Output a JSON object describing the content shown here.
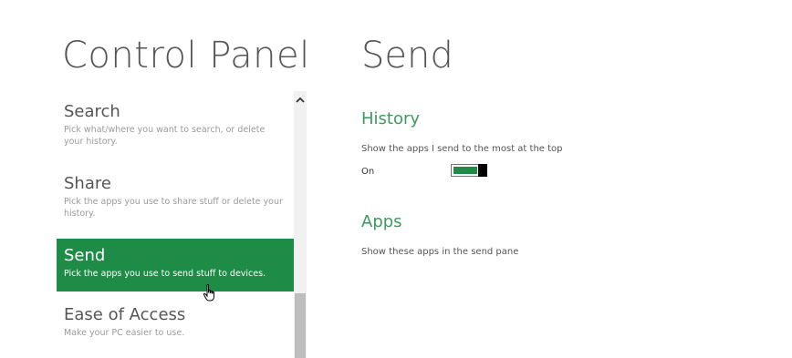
{
  "left_panel": {
    "title": "Control Panel",
    "items": [
      {
        "title": "Search",
        "desc": "Pick what/where you want to search, or delete your history."
      },
      {
        "title": "Share",
        "desc": "Pick the apps you use to share stuff or delete your history."
      },
      {
        "title": "Send",
        "desc": "Pick the apps you use to send stuff to devices."
      },
      {
        "title": "Ease of Access",
        "desc": "Make your PC easier to use."
      }
    ],
    "selected_index": 2
  },
  "right_panel": {
    "title": "Send",
    "history": {
      "heading": "History",
      "description": "Show the apps I send to the most at the top",
      "toggle_label": "On",
      "toggle_on": true
    },
    "apps": {
      "heading": "Apps",
      "description": "Show these apps in the send pane"
    }
  },
  "icons": {
    "scroll_up": "chevron-up-icon",
    "cursor": "hand-pointer-icon"
  },
  "colors": {
    "accent": "#1e8c46",
    "heading_green": "#3d9a5e",
    "text": "#555555"
  }
}
